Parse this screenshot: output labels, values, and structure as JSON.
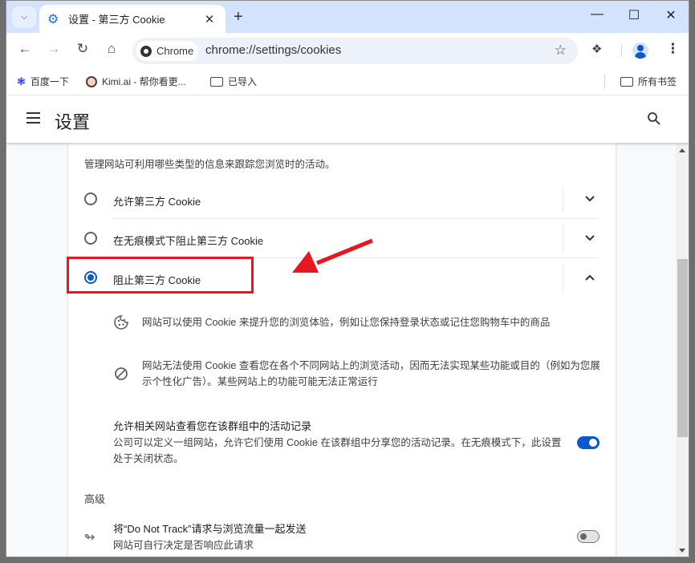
{
  "browser": {
    "tab_title": "设置 - 第三方 Cookie",
    "omnibox_chip": "Chrome",
    "url": "chrome://settings/cookies",
    "bookmarks": [
      {
        "label": "百度一下",
        "icon": "baidu-paw-icon"
      },
      {
        "label": "Kimi.ai - 帮你看更...",
        "icon": "kimi-avatar-icon"
      },
      {
        "label": "已导入",
        "icon": "folder-icon"
      }
    ],
    "all_bookmarks": "所有书签"
  },
  "settings": {
    "title": "设置",
    "intro": "管理网站可利用哪些类型的信息来跟踪您浏览时的活动。",
    "options": [
      {
        "label": "允许第三方 Cookie",
        "selected": false,
        "expanded": false
      },
      {
        "label": "在无痕模式下阻止第三方 Cookie",
        "selected": false,
        "expanded": false
      },
      {
        "label": "阻止第三方 Cookie",
        "selected": true,
        "expanded": true
      }
    ],
    "details": [
      {
        "icon": "cookie-icon",
        "text": "网站可以使用 Cookie 来提升您的浏览体验，例如让您保持登录状态或记住您购物车中的商品"
      },
      {
        "icon": "block-icon",
        "text": "网站无法使用 Cookie 查看您在各个不同网站上的浏览活动，因而无法实现某些功能或目的（例如为您展示个性化广告）。某些网站上的功能可能无法正常运行"
      }
    ],
    "related_sites": {
      "title": "允许相关网站查看您在该群组中的活动记录",
      "subtitle": "公司可以定义一组网站，允许它们使用 Cookie 在该群组中分享您的活动记录。在无痕模式下，此设置处于关闭状态。",
      "enabled": true
    },
    "advanced_label": "高级",
    "do_not_track": {
      "title": "将“Do Not Track”请求与浏览流量一起发送",
      "subtitle": "网站可自行决定是否响应此请求",
      "enabled": false
    }
  },
  "annotation": {
    "highlight_color": "#e8161f",
    "highlighted_option": "阻止第三方 Cookie"
  },
  "colors": {
    "accent": "#0b57d0",
    "tabstrip": "#d3e3fd"
  }
}
